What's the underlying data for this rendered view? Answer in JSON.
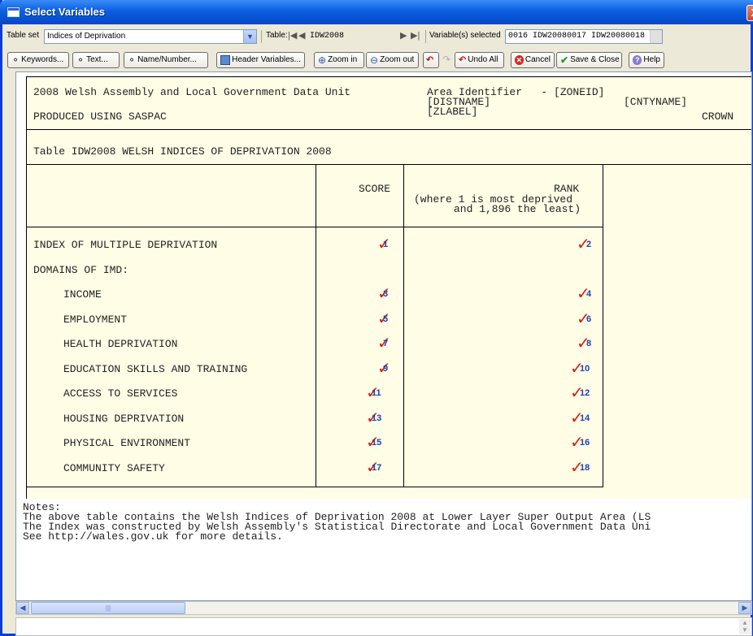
{
  "window": {
    "title": "Select Variables",
    "close_glyph": "X"
  },
  "row1": {
    "tableset_label": "Table set",
    "tableset_value": "Indices of Deprivation",
    "table_label": "Table:",
    "table_value": "IDW2008",
    "selected_label": "Variable(s) selected",
    "selected_value": "0016 IDW20080017 IDW20080018"
  },
  "toolbar": {
    "keywords": "Keywords...",
    "text": "Text...",
    "name_number": "Name/Number...",
    "header_variables": "Header Variables...",
    "zoom_in": "Zoom in",
    "zoom_out": "Zoom out",
    "undo_all": "Undo All",
    "cancel": "Cancel",
    "save_close": "Save & Close",
    "help": "Help"
  },
  "document": {
    "header_line1_left": "2008 Welsh Assembly and Local Government Data Unit",
    "header_line1_right": "Area Identifier   - [ZONEID]",
    "header_line2_mid": "[DISTNAME]",
    "header_line2_right": "[CNTYNAME]",
    "header_line3_left": "PRODUCED USING SASPAC",
    "header_line3_mid": "[ZLABEL]",
    "header_line3_right": "CROWN",
    "table_title": "Table IDW2008 WELSH INDICES OF DEPRIVATION 2008",
    "col_score": "SCORE",
    "col_rank_1": "RANK",
    "col_rank_2": "(where 1 is most deprived",
    "col_rank_3": "and 1,896 the least)",
    "rows": [
      {
        "label": "INDEX OF MULTIPLE DEPRIVATION",
        "score": "1",
        "rank": "2",
        "indent": false
      },
      {
        "label": "DOMAINS OF IMD:",
        "score": "",
        "rank": "",
        "indent": false
      },
      {
        "label": "INCOME",
        "score": "3",
        "rank": "4",
        "indent": true
      },
      {
        "label": "EMPLOYMENT",
        "score": "5",
        "rank": "6",
        "indent": true
      },
      {
        "label": "HEALTH DEPRIVATION",
        "score": "7",
        "rank": "8",
        "indent": true
      },
      {
        "label": "EDUCATION SKILLS AND TRAINING",
        "score": "9",
        "rank": "10",
        "indent": true
      },
      {
        "label": "ACCESS TO SERVICES",
        "score": "11",
        "rank": "12",
        "indent": true
      },
      {
        "label": "HOUSING DEPRIVATION",
        "score": "13",
        "rank": "14",
        "indent": true
      },
      {
        "label": "PHYSICAL ENVIRONMENT",
        "score": "15",
        "rank": "16",
        "indent": true
      },
      {
        "label": "COMMUNITY SAFETY",
        "score": "17",
        "rank": "18",
        "indent": true
      }
    ],
    "notes_title": "Notes:",
    "notes_1": "The above table contains the Welsh Indices of Deprivation 2008 at Lower Layer Super Output Area (LS",
    "notes_2": "The Index was constructed by Welsh Assembly's Statistical Directorate and Local Government Data Uni",
    "notes_3": "See http://wales.gov.uk for more details."
  },
  "icons": {
    "tick": "checkmark-icon",
    "binoculars": "binoculars-icon"
  },
  "colors": {
    "tick": "#d02010",
    "tick_number": "#2040b0",
    "page_bg": "#fffde6"
  }
}
